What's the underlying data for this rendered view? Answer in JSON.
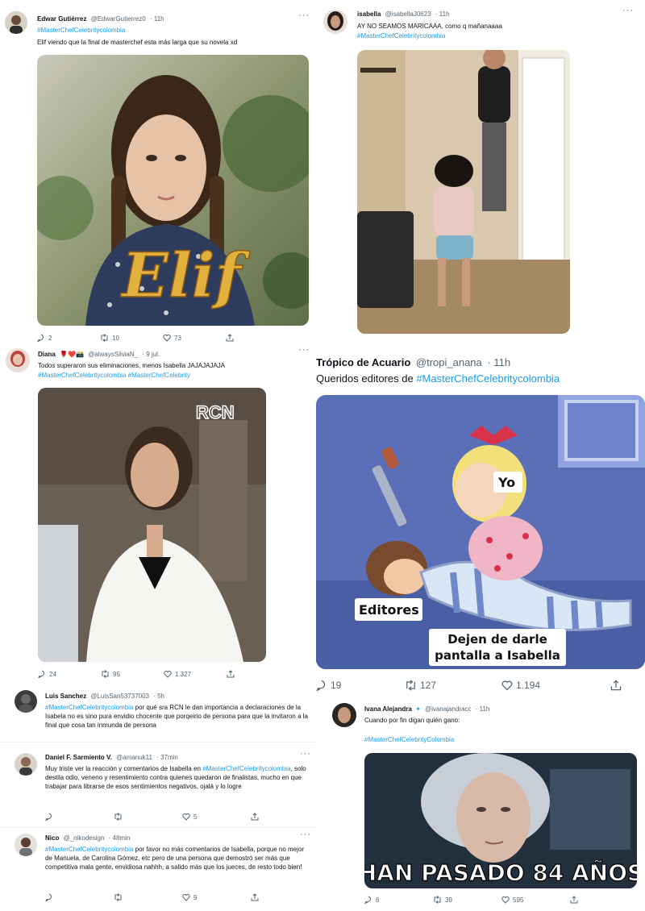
{
  "tweets": {
    "t1": {
      "name": "Edwar Gutiérrez",
      "handle": "@EdwarGutierrez0",
      "time": "· 11h",
      "hashtag": "#MasterChefCelebritycolombia",
      "text": "Elif viendo que la final de masterchef esta más larga que su novela xd",
      "media_title": "Elif",
      "replies": "2",
      "retweets": "10",
      "likes": "73"
    },
    "t2": {
      "name": "isabella",
      "handle": "@isabellaJ0623",
      "time": "· 11h",
      "text": "AY NO SEAMOS MARICAAA, como q mañanaaaa",
      "hashtag": "#MasterChefCelebritycolombia"
    },
    "t3": {
      "name": "Diana",
      "name_emoji": "🌹❤️📸",
      "handle": "@alwaysSilviaN_",
      "time": "· 9 jul.",
      "text": "Todos superaron sus eliminaciones, menos Isabella JAJAJAJAJA",
      "hashtag1": "#MasterChefCelebritycolombia",
      "hashtag2": "#MasterChefCelebrity",
      "watermark": "RCN",
      "replies": "24",
      "retweets": "95",
      "likes": "1.327"
    },
    "t4": {
      "name": "Trópico de Acuario",
      "handle": "@tropi_anana",
      "time": "· 11h",
      "text": "Queridos editores de",
      "hashtag": "#MasterChefCelebritycolombia",
      "meme_yo": "Yo",
      "meme_editores": "Editores",
      "meme_caption": "Dejen de darle pantalla a Isabella",
      "replies": "19",
      "retweets": "127",
      "likes": "1.194"
    },
    "t5": {
      "name": "Luis Sanchez",
      "handle": "@LuisSan53737003",
      "time": "· 5h",
      "hashtag": "#MasterChefCelebritycolombia",
      "text": " por qué sra RCN le dan importancia a declaraciones  de la Isabela no es sino pura envidio chocente que porqeirio de persona para que la invitaron a la final que cosa tan inmunda de persona"
    },
    "t6": {
      "name": "Daniel F. Sarmiento V.",
      "handle": "@amanuk11",
      "time": "· 37min",
      "text_before": "Muy triste ver la reacción y comentarios de Isabella en",
      "hashtag": "#MasterChefCelebritycolombia",
      "text_after": ", solo destila odio, veneno y resentimiento contra quienes quedaron de finalistas, mucho en que trabajar para librarse de esos sentimientos negativos, ojalá y lo logre",
      "likes": "5"
    },
    "t7": {
      "name": "Nico",
      "handle": "@_nikodesign",
      "time": "· 48min",
      "hashtag": "#MasterChefCelebritycolombia",
      "text": " por favor no más comentarios de Isabella, porque no mejor de Manuela, de Carolina Gómez, etc pero de una persona que demostró ser más que competitiva mala gente, envidiosa nahhh, a salido más que los jueces, de resto todo bien!",
      "likes": "9"
    },
    "t8": {
      "name": "Ivana Alejandra",
      "handle": "@ivanajandracc",
      "time": "· 11h",
      "text": "Cuando por fin digan quién gano:",
      "hashtag": "#MasterChefCelebrityColombia",
      "meme_caption": "HAN PASADO 84 AÑOS",
      "replies": "6",
      "retweets": "39",
      "likes": "595"
    }
  },
  "colors": {
    "accent": "#1d9bf0",
    "text": "#0f1419",
    "muted": "#536471"
  }
}
